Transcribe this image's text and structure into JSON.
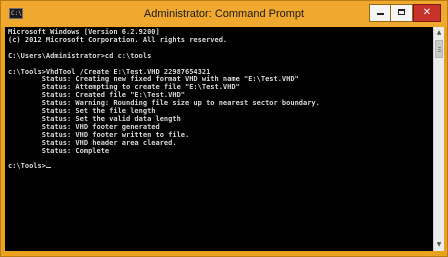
{
  "window": {
    "title": "Administrator: Command Prompt",
    "app_icon_glyph": "C:\\",
    "controls": {
      "minimize_icon": "minimize-icon",
      "maximize_icon": "maximize-icon",
      "close_glyph": "✕"
    }
  },
  "console": {
    "lines": [
      "Microsoft Windows [Version 6.2.9200]",
      "(c) 2012 Microsoft Corporation. All rights reserved.",
      "",
      "C:\\Users\\Administrator>cd c:\\tools",
      "",
      "c:\\Tools>VhdTool /Create E:\\Test.VHD 22987654321",
      "        Status: Creating new fixed format VHD with name \"E:\\Test.VHD\"",
      "        Status: Attempting to create file \"E:\\Test.VHD\"",
      "        Status: Created file \"E:\\Test.VHD\"",
      "        Status: Warning: Rounding file size up to nearest sector boundary.",
      "        Status: Set the file length",
      "        Status: Set the valid data length",
      "        Status: VHD footer generated",
      "        Status: VHD footer written to file.",
      "        Status: VHD header area cleared.",
      "        Status: Complete",
      "",
      "c:\\Tools>"
    ]
  },
  "scrollbar": {
    "up_glyph": "▲",
    "down_glyph": "▼"
  },
  "colors": {
    "titlebar": "#f0a92e",
    "console_background": "#000000",
    "console_text": "#d8d8d8",
    "close_button": "#c7332a"
  }
}
